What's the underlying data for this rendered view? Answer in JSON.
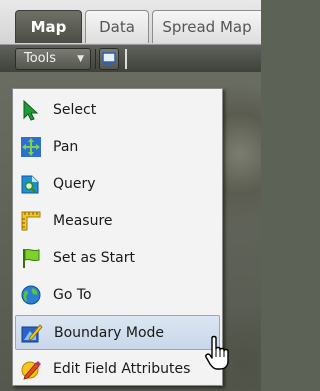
{
  "tabs": [
    {
      "label": "Map",
      "active": true
    },
    {
      "label": "Data",
      "active": false
    },
    {
      "label": "Spread Map",
      "active": false
    }
  ],
  "toolbar": {
    "tools_label": "Tools",
    "print_icon": "monitor-icon"
  },
  "menu": {
    "items": [
      {
        "label": "Select",
        "icon": "select-arrow-icon"
      },
      {
        "label": "Pan",
        "icon": "pan-arrows-icon"
      },
      {
        "label": "Query",
        "icon": "query-icon"
      },
      {
        "label": "Measure",
        "icon": "ruler-icon"
      },
      {
        "label": "Set as Start",
        "icon": "flag-icon"
      },
      {
        "label": "Go To",
        "icon": "globe-icon"
      },
      {
        "label": "Boundary Mode",
        "icon": "boundary-icon",
        "hovered": true
      },
      {
        "label": "Edit Field Attributes",
        "icon": "pencil-icon"
      }
    ]
  },
  "colors": {
    "active_tab": "#55574f",
    "menu_bg": "#f3f3f3",
    "hover_bg": "#d3deee"
  }
}
